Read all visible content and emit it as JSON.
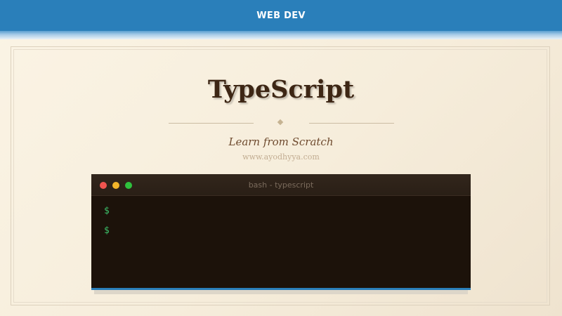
{
  "header": {
    "label": "WEB DEV",
    "color": "#2a7fba"
  },
  "hero": {
    "title": "TypeScript",
    "subtitle": "Learn from Scratch",
    "url": "www.ayodhyya.com"
  },
  "terminal": {
    "title": "bash - typescript",
    "buttons": [
      "close",
      "minimize",
      "maximize"
    ],
    "lines": [
      {
        "prompt": "$"
      },
      {
        "prompt": "$"
      }
    ]
  }
}
